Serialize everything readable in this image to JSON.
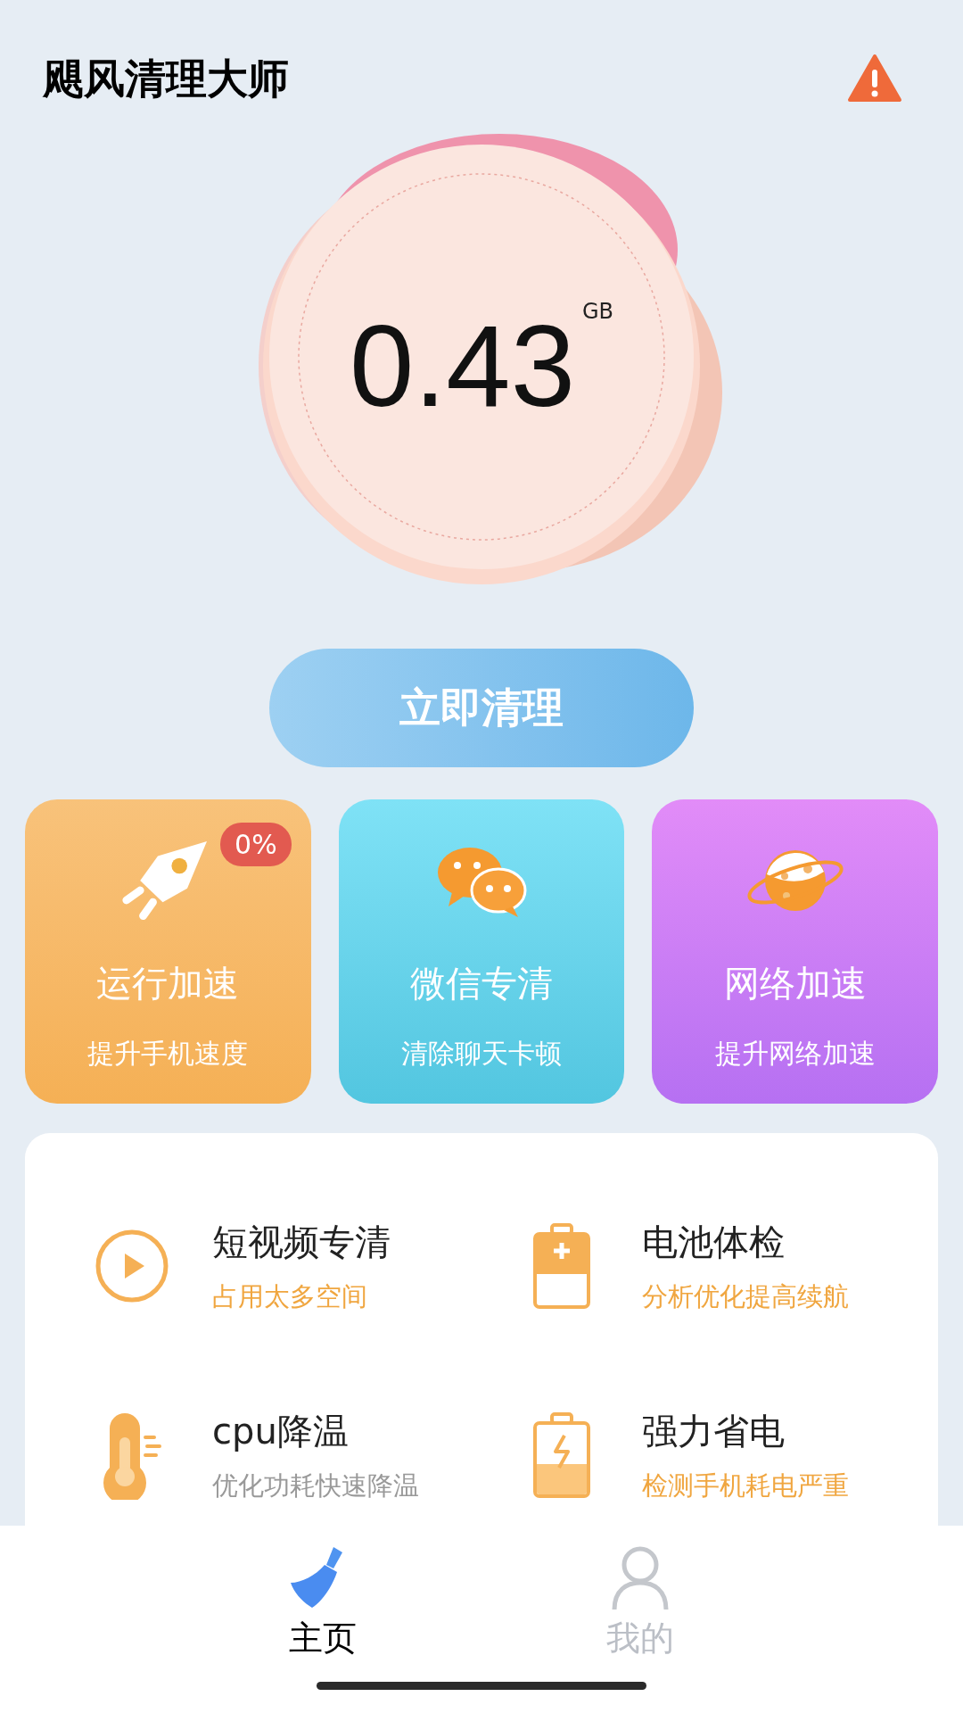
{
  "header": {
    "title": "飓风清理大师"
  },
  "storage": {
    "value": "0.43",
    "unit": "GB"
  },
  "clean_button": {
    "label": "立即清理"
  },
  "cards": [
    {
      "title": "运行加速",
      "subtitle": "提升手机速度",
      "badge": "0%"
    },
    {
      "title": "微信专清",
      "subtitle": "清除聊天卡顿"
    },
    {
      "title": "网络加速",
      "subtitle": "提升网络加速"
    }
  ],
  "features": [
    {
      "title": "短视频专清",
      "subtitle": "占用太多空间",
      "color": "#f0a640"
    },
    {
      "title": "电池体检",
      "subtitle": "分析优化提高续航",
      "color": "#f0a640"
    },
    {
      "title": "cpu降温",
      "subtitle": "优化功耗快速降温",
      "color": "#999999"
    },
    {
      "title": "强力省电",
      "subtitle": "检测手机耗电严重",
      "color": "#f0a640"
    }
  ],
  "tab_bar": [
    {
      "label": "主页",
      "selected": true
    },
    {
      "label": "我的",
      "selected": false
    }
  ]
}
